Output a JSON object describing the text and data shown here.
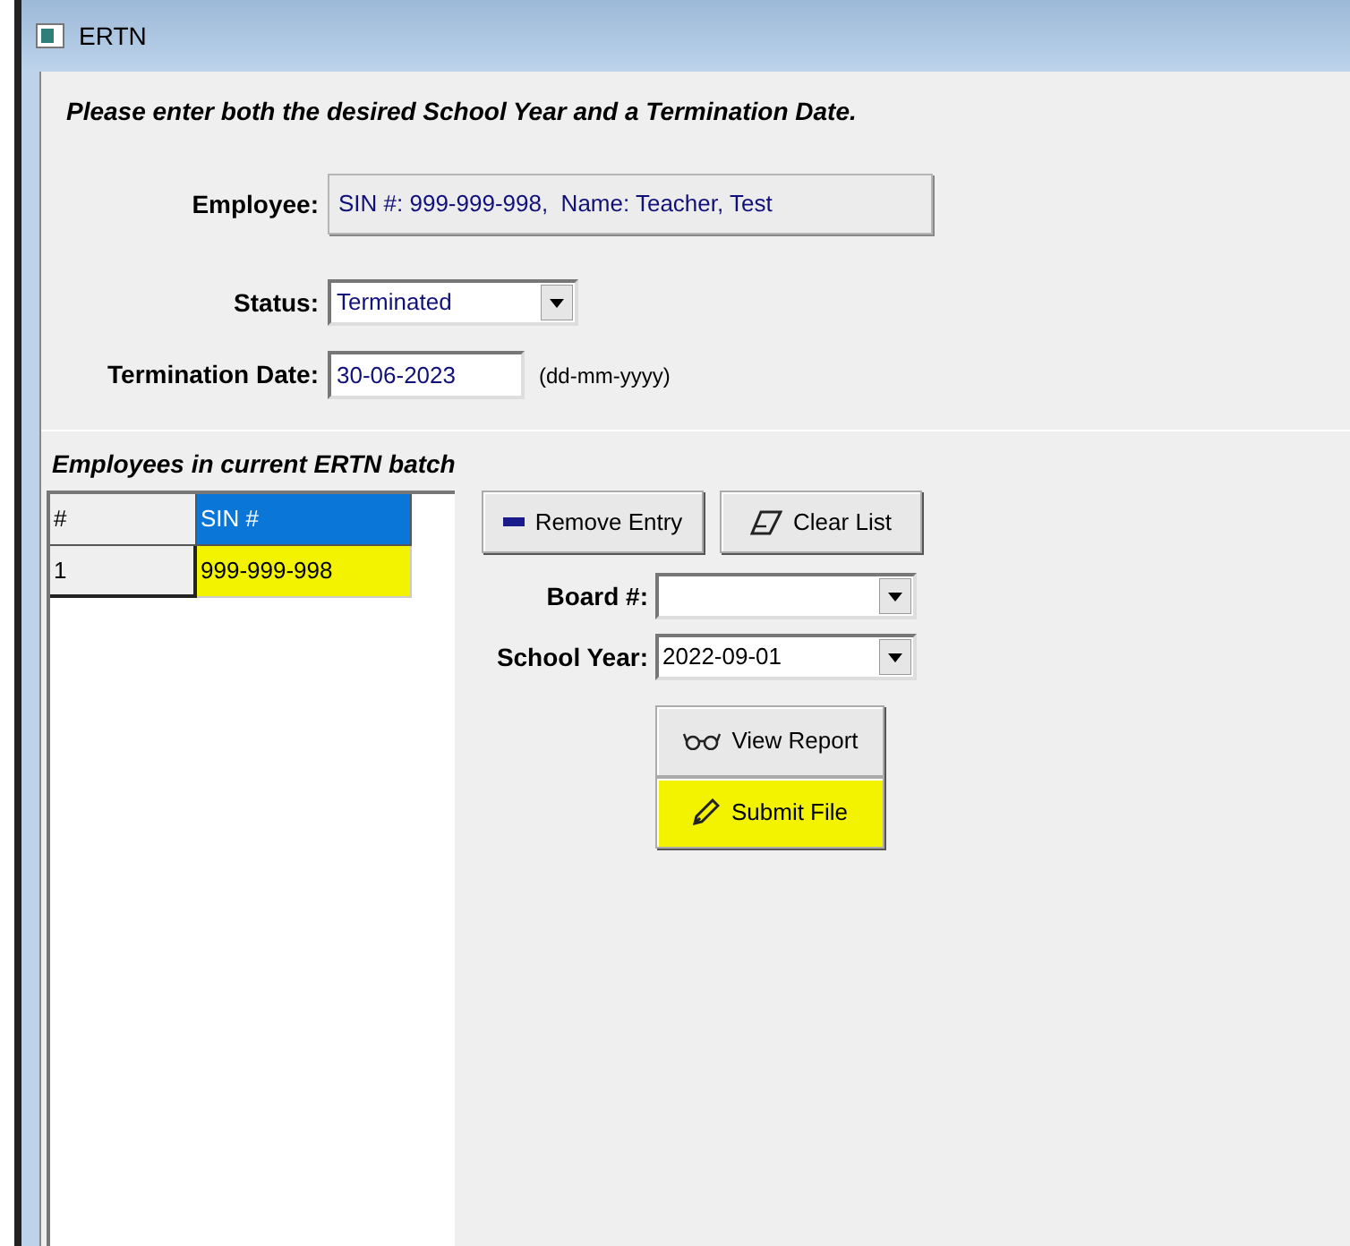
{
  "window": {
    "title": "ERTN"
  },
  "instruction": "Please enter both the desired School Year and a Termination Date.",
  "employee": {
    "label": "Employee:",
    "value": "SIN #: 999-999-998,  Name: Teacher, Test"
  },
  "status": {
    "label": "Status:",
    "value": "Terminated"
  },
  "termination_date": {
    "label": "Termination Date:",
    "value": "30-06-2023",
    "hint": "(dd-mm-yyyy)"
  },
  "batch": {
    "title": "Employees in current ERTN batch",
    "columns": [
      {
        "label": "#",
        "selected": false
      },
      {
        "label": "SIN #",
        "selected": true
      }
    ],
    "rows": [
      {
        "cells": [
          "1",
          "999-999-998"
        ],
        "highlighted": true
      }
    ]
  },
  "buttons": [
    {
      "label": "Remove Entry",
      "kind": "remove",
      "highlighted": false
    },
    {
      "label": "Clear List",
      "kind": "clear",
      "highlighted": false
    }
  ],
  "board": {
    "label": "Board #:"
  },
  "school_year": {
    "label": "School Year:",
    "value": "2022-09-01"
  },
  "actions": [
    {
      "label": "View Report",
      "kind": "view",
      "highlighted": false
    },
    {
      "label": "Submit File",
      "kind": "submit",
      "highlighted": true
    }
  ]
}
